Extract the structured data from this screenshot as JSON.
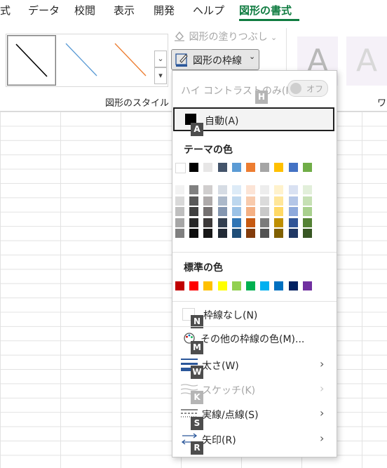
{
  "tabs": [
    "式",
    "データ",
    "校閲",
    "表示",
    "開発",
    "ヘルプ",
    "図形の書式"
  ],
  "ribbon": {
    "shape_styles_label": "図形のスタイル",
    "fill_button": "図形の塗りつぶし",
    "outline_button": "図形の枠線",
    "wordart_letter": "A",
    "wordart_group_label_partial": "ワ"
  },
  "menu": {
    "high_contrast": "ハイ コントラストのみ(H)",
    "high_contrast_toggle": "オフ",
    "auto": {
      "label": "自動(A)",
      "key": "A"
    },
    "theme_colors_heading": "テーマの色",
    "theme_colors": [
      "#FFFFFF",
      "#000000",
      "#E7E6E6",
      "#44546A",
      "#5B9BD5",
      "#ED7D31",
      "#A5A5A5",
      "#FFC000",
      "#4472C4",
      "#70AD47"
    ],
    "theme_shades": [
      [
        "#F2F2F2",
        "#D9D9D9",
        "#BFBFBF",
        "#A6A6A6",
        "#808080"
      ],
      [
        "#808080",
        "#595959",
        "#404040",
        "#262626",
        "#0D0D0D"
      ],
      [
        "#D0CECE",
        "#AEAAAA",
        "#757171",
        "#3B3838",
        "#171717"
      ],
      [
        "#D6DCE4",
        "#ACB9CA",
        "#8496B0",
        "#333F4F",
        "#222A35"
      ],
      [
        "#DDEBF7",
        "#BDD7EE",
        "#9BC2E6",
        "#2F75B5",
        "#1F4E78"
      ],
      [
        "#FCE4D6",
        "#F8CBAD",
        "#F4B084",
        "#C65911",
        "#833C0C"
      ],
      [
        "#EDEDED",
        "#DBDBDB",
        "#C9C9C9",
        "#7B7B7B",
        "#525252"
      ],
      [
        "#FFF2CC",
        "#FFE699",
        "#FFD966",
        "#BF8F00",
        "#806000"
      ],
      [
        "#D9E1F2",
        "#B4C6E7",
        "#8EA9DB",
        "#305496",
        "#203764"
      ],
      [
        "#E2EFDA",
        "#C6E0B4",
        "#A9D08E",
        "#548235",
        "#375623"
      ]
    ],
    "standard_colors_heading": "標準の色",
    "standard_colors": [
      "#C00000",
      "#FF0000",
      "#FFC000",
      "#FFFF00",
      "#92D050",
      "#00B050",
      "#00B0F0",
      "#0070C0",
      "#002060",
      "#7030A0"
    ],
    "no_outline": {
      "label": "枠線なし(N)",
      "key": "N"
    },
    "more_colors": {
      "label": "その他の枠線の色(M)...",
      "key": "M"
    },
    "weight": {
      "label": "太さ(W)",
      "key": "W"
    },
    "sketch": {
      "label": "スケッチ(K)",
      "key": "K"
    },
    "dashes": {
      "label": "実線/点線(S)",
      "key": "S"
    },
    "arrows": {
      "label": "矢印(R)",
      "key": "R"
    },
    "high_contrast_key": "H"
  }
}
